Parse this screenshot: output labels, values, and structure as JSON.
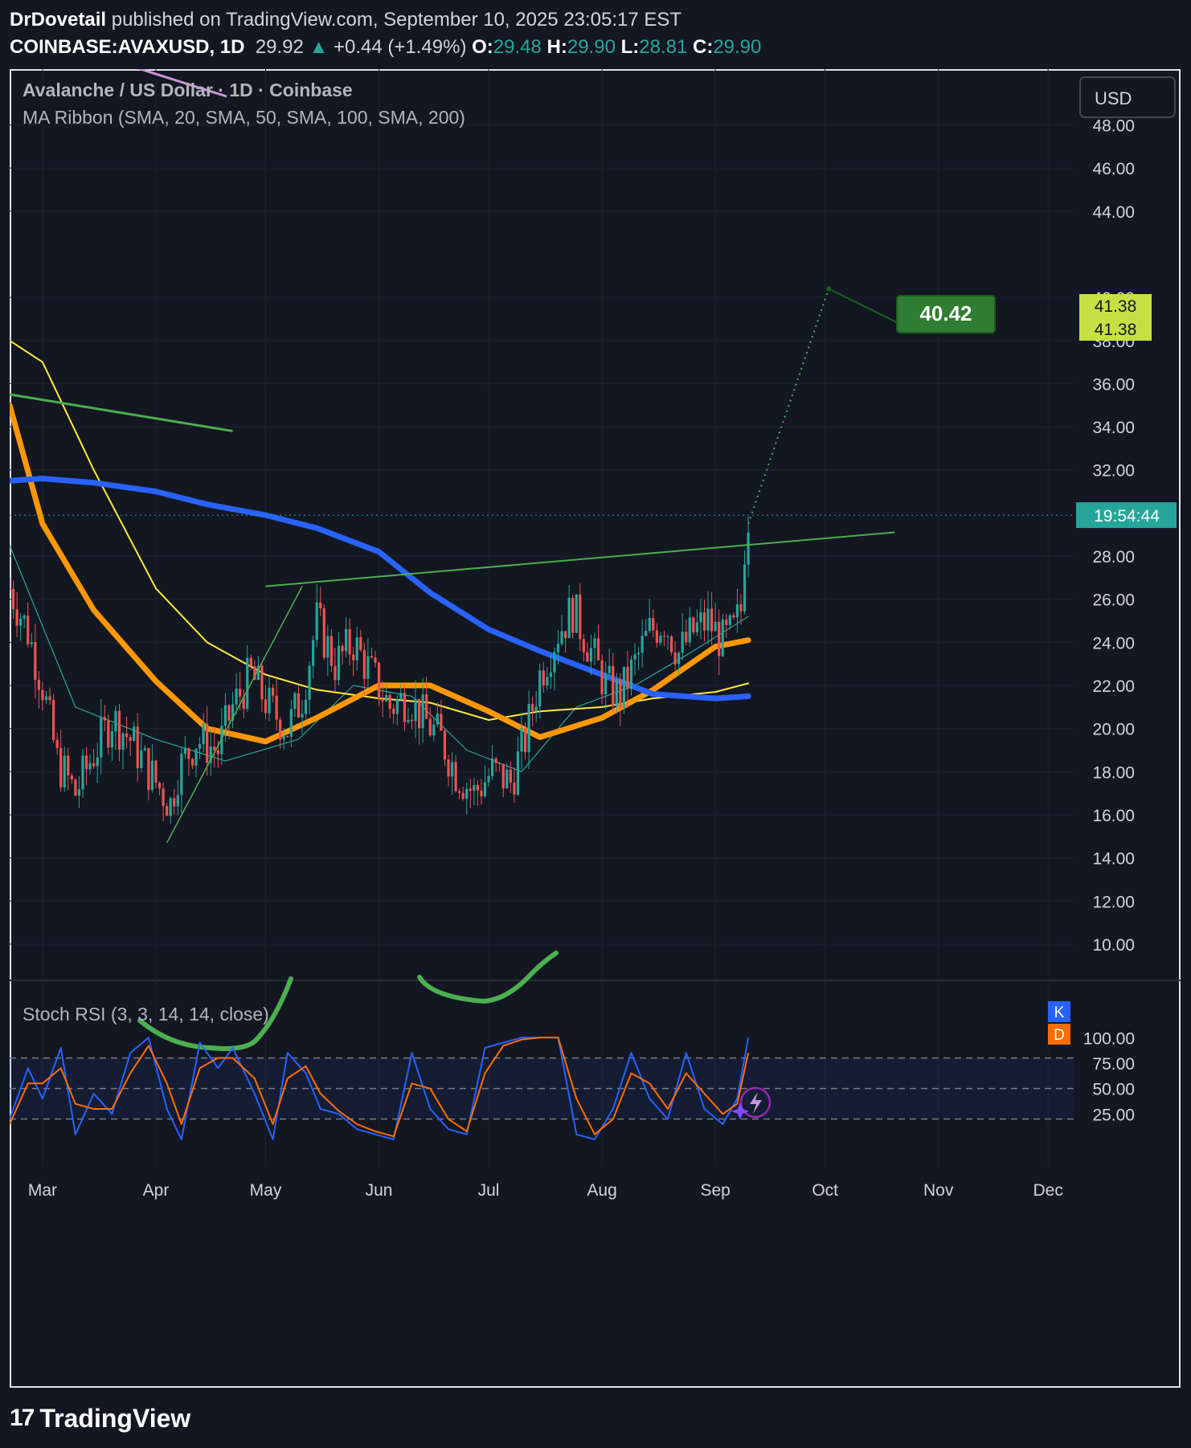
{
  "header": {
    "author": "DrDovetail",
    "published": "published on TradingView.com, September 10, 2025 23:05:17 EST",
    "symbol": "COINBASE:AVAXUSD, 1D",
    "last": "29.92",
    "change": "+0.44 (+1.49%)",
    "o_label": "O:",
    "o": "29.48",
    "h_label": "H:",
    "h": "29.90",
    "l_label": "L:",
    "l": "28.81",
    "c_label": "C:",
    "c": "29.90"
  },
  "legend": {
    "title": "Avalanche / US Dollar · 1D · Coinbase",
    "ma": "MA Ribbon (SMA, 20, SMA, 50, SMA, 100, SMA, 200)",
    "stoch": "Stoch RSI (3, 3, 14, 14, close)"
  },
  "currency_button": "USD",
  "price_badges": {
    "target_label": "40.42",
    "level_a": "41.38",
    "level_b": "41.38",
    "countdown": "19:54:44"
  },
  "osc_legend": {
    "k": "K",
    "d": "D"
  },
  "footer": {
    "logo": "TradingView"
  },
  "colors": {
    "background": "#131722",
    "up": "#26a69a",
    "down": "#ef5350",
    "ma20": "#26a69a",
    "ma50": "#ffeb3b",
    "ma100": "#ff9800",
    "ma200": "#2962ff",
    "drawing": "#4caf50",
    "k_line": "#2962ff",
    "d_line": "#ff6d00"
  },
  "chart_data": [
    {
      "type": "candlestick",
      "title": "Avalanche / US Dollar · 1D · Coinbase",
      "y_ticks": [
        "10.00",
        "12.00",
        "14.00",
        "16.00",
        "18.00",
        "20.00",
        "22.00",
        "24.00",
        "26.00",
        "28.00",
        "32.00",
        "34.00",
        "36.00",
        "38.00",
        "40.00",
        "44.00",
        "46.00",
        "48.00"
      ],
      "y_range": [
        10,
        50
      ],
      "x_ticks": [
        "Mar",
        "Apr",
        "May",
        "Jun",
        "Jul",
        "Aug",
        "Sep",
        "Oct",
        "Nov",
        "Dec"
      ],
      "x_range": [
        "2025-02-20",
        "2025-12-10"
      ],
      "grid": true,
      "close_series": {
        "dates": [
          "2025-02-20",
          "2025-02-25",
          "2025-03-01",
          "2025-03-05",
          "2025-03-10",
          "2025-03-14",
          "2025-03-20",
          "2025-03-25",
          "2025-04-01",
          "2025-04-05",
          "2025-04-07",
          "2025-04-12",
          "2025-04-18",
          "2025-04-22",
          "2025-04-27",
          "2025-05-02",
          "2025-05-07",
          "2025-05-11",
          "2025-05-15",
          "2025-05-20",
          "2025-05-25",
          "2025-05-30",
          "2025-06-04",
          "2025-06-09",
          "2025-06-13",
          "2025-06-18",
          "2025-06-22",
          "2025-06-27",
          "2025-07-02",
          "2025-07-07",
          "2025-07-11",
          "2025-07-15",
          "2025-07-20",
          "2025-07-24",
          "2025-07-28",
          "2025-08-02",
          "2025-08-06",
          "2025-08-10",
          "2025-08-14",
          "2025-08-18",
          "2025-08-22",
          "2025-08-26",
          "2025-08-30",
          "2025-09-03",
          "2025-09-06",
          "2025-09-08",
          "2025-09-09",
          "2025-09-10"
        ],
        "close": [
          26.5,
          24.5,
          22.0,
          18.5,
          17.0,
          18.5,
          20.5,
          19.5,
          17.5,
          16.5,
          18.0,
          19.5,
          19.0,
          21.0,
          22.5,
          21.0,
          20.0,
          21.5,
          25.0,
          23.0,
          24.0,
          22.5,
          21.0,
          21.5,
          20.5,
          19.5,
          18.0,
          17.0,
          18.0,
          17.5,
          19.5,
          22.5,
          24.5,
          25.5,
          24.0,
          22.0,
          21.5,
          23.0,
          24.5,
          25.0,
          23.5,
          24.5,
          25.0,
          24.0,
          24.5,
          25.5,
          28.5,
          29.9
        ]
      },
      "current_price": 29.9,
      "countdown": "19:54:44",
      "series": [
        {
          "name": "SMA 20",
          "dates": [
            "2025-02-20",
            "2025-03-10",
            "2025-04-01",
            "2025-04-20",
            "2025-05-10",
            "2025-05-25",
            "2025-06-10",
            "2025-06-25",
            "2025-07-10",
            "2025-07-25",
            "2025-08-10",
            "2025-08-25",
            "2025-09-10"
          ],
          "values": [
            28.5,
            21.0,
            19.5,
            18.5,
            19.5,
            22.0,
            21.5,
            19.0,
            18.0,
            21.0,
            22.0,
            23.5,
            25.2
          ]
        },
        {
          "name": "SMA 50",
          "dates": [
            "2025-02-20",
            "2025-03-01",
            "2025-03-15",
            "2025-04-01",
            "2025-04-15",
            "2025-05-01",
            "2025-05-15",
            "2025-06-01",
            "2025-06-15",
            "2025-07-01",
            "2025-07-15",
            "2025-08-01",
            "2025-08-15",
            "2025-09-01",
            "2025-09-10"
          ],
          "values": [
            38.0,
            37.0,
            32.0,
            26.5,
            24.0,
            22.5,
            21.8,
            21.4,
            21.2,
            20.4,
            20.8,
            21.0,
            21.4,
            21.7,
            22.1
          ]
        },
        {
          "name": "SMA 100",
          "dates": [
            "2025-02-20",
            "2025-03-01",
            "2025-03-15",
            "2025-04-01",
            "2025-04-15",
            "2025-05-01",
            "2025-05-15",
            "2025-06-01",
            "2025-06-15",
            "2025-07-01",
            "2025-07-15",
            "2025-08-01",
            "2025-08-15",
            "2025-09-01",
            "2025-09-10"
          ],
          "values": [
            35.0,
            29.5,
            25.5,
            22.2,
            20.0,
            19.4,
            20.5,
            22.0,
            22.0,
            20.8,
            19.6,
            20.5,
            21.8,
            23.8,
            24.1
          ]
        },
        {
          "name": "SMA 200",
          "dates": [
            "2025-02-20",
            "2025-03-01",
            "2025-03-15",
            "2025-04-01",
            "2025-04-15",
            "2025-05-01",
            "2025-05-15",
            "2025-06-01",
            "2025-06-15",
            "2025-07-01",
            "2025-07-15",
            "2025-08-01",
            "2025-08-15",
            "2025-09-01",
            "2025-09-10"
          ],
          "values": [
            31.5,
            31.6,
            31.4,
            31.0,
            30.4,
            29.9,
            29.3,
            28.2,
            26.3,
            24.6,
            23.6,
            22.5,
            21.6,
            21.4,
            21.5
          ]
        }
      ],
      "annotations": {
        "resistance_line": {
          "from": [
            "2025-05-01",
            26.6
          ],
          "to": [
            "2025-10-20",
            29.1
          ]
        },
        "downtrend_line": {
          "from": [
            "2025-02-20",
            35.5
          ],
          "to": [
            "2025-04-22",
            33.8
          ]
        },
        "support_line": {
          "from": [
            "2025-04-04",
            14.7
          ],
          "to": [
            "2025-05-11",
            26.6
          ]
        },
        "projection": {
          "from": [
            "2025-09-10",
            29.5
          ],
          "to": [
            "2025-10-02",
            40.4
          ],
          "label": "40.42"
        },
        "price_level": 41.38
      }
    },
    {
      "type": "line",
      "title": "Stoch RSI (3, 3, 14, 14, close)",
      "y_ticks": [
        "25.00",
        "50.00",
        "75.00",
        "100.00"
      ],
      "y_range": [
        0,
        100
      ],
      "bands": [
        20,
        50,
        80
      ],
      "series": [
        {
          "name": "K",
          "dates": [
            "2025-02-20",
            "2025-02-25",
            "2025-03-01",
            "2025-03-06",
            "2025-03-10",
            "2025-03-15",
            "2025-03-20",
            "2025-03-25",
            "2025-03-30",
            "2025-04-04",
            "2025-04-08",
            "2025-04-13",
            "2025-04-18",
            "2025-04-22",
            "2025-04-28",
            "2025-05-03",
            "2025-05-07",
            "2025-05-12",
            "2025-05-16",
            "2025-05-21",
            "2025-05-26",
            "2025-05-31",
            "2025-06-05",
            "2025-06-10",
            "2025-06-15",
            "2025-06-20",
            "2025-06-25",
            "2025-06-30",
            "2025-07-05",
            "2025-07-10",
            "2025-07-15",
            "2025-07-20",
            "2025-07-25",
            "2025-07-30",
            "2025-08-04",
            "2025-08-09",
            "2025-08-14",
            "2025-08-19",
            "2025-08-24",
            "2025-08-29",
            "2025-09-03",
            "2025-09-07",
            "2025-09-10"
          ],
          "values": [
            20,
            70,
            40,
            90,
            5,
            45,
            25,
            85,
            100,
            30,
            0,
            95,
            70,
            90,
            45,
            0,
            85,
            65,
            30,
            25,
            10,
            5,
            0,
            85,
            30,
            10,
            5,
            90,
            95,
            100,
            100,
            100,
            5,
            0,
            30,
            85,
            40,
            20,
            85,
            30,
            15,
            40,
            100
          ]
        },
        {
          "name": "D",
          "dates": [
            "2025-02-20",
            "2025-02-25",
            "2025-03-01",
            "2025-03-06",
            "2025-03-10",
            "2025-03-15",
            "2025-03-20",
            "2025-03-25",
            "2025-03-30",
            "2025-04-04",
            "2025-04-08",
            "2025-04-13",
            "2025-04-18",
            "2025-04-22",
            "2025-04-28",
            "2025-05-03",
            "2025-05-07",
            "2025-05-12",
            "2025-05-16",
            "2025-05-21",
            "2025-05-26",
            "2025-05-31",
            "2025-06-05",
            "2025-06-10",
            "2025-06-15",
            "2025-06-20",
            "2025-06-25",
            "2025-06-30",
            "2025-07-05",
            "2025-07-10",
            "2025-07-15",
            "2025-07-20",
            "2025-07-25",
            "2025-07-30",
            "2025-08-04",
            "2025-08-09",
            "2025-08-14",
            "2025-08-19",
            "2025-08-24",
            "2025-08-29",
            "2025-09-03",
            "2025-09-07",
            "2025-09-10"
          ],
          "values": [
            15,
            55,
            55,
            70,
            35,
            30,
            30,
            65,
            92,
            55,
            15,
            70,
            80,
            80,
            60,
            15,
            60,
            72,
            45,
            28,
            15,
            8,
            3,
            55,
            50,
            20,
            8,
            65,
            92,
            98,
            100,
            100,
            40,
            5,
            20,
            65,
            55,
            30,
            65,
            45,
            25,
            35,
            85
          ]
        }
      ]
    }
  ]
}
